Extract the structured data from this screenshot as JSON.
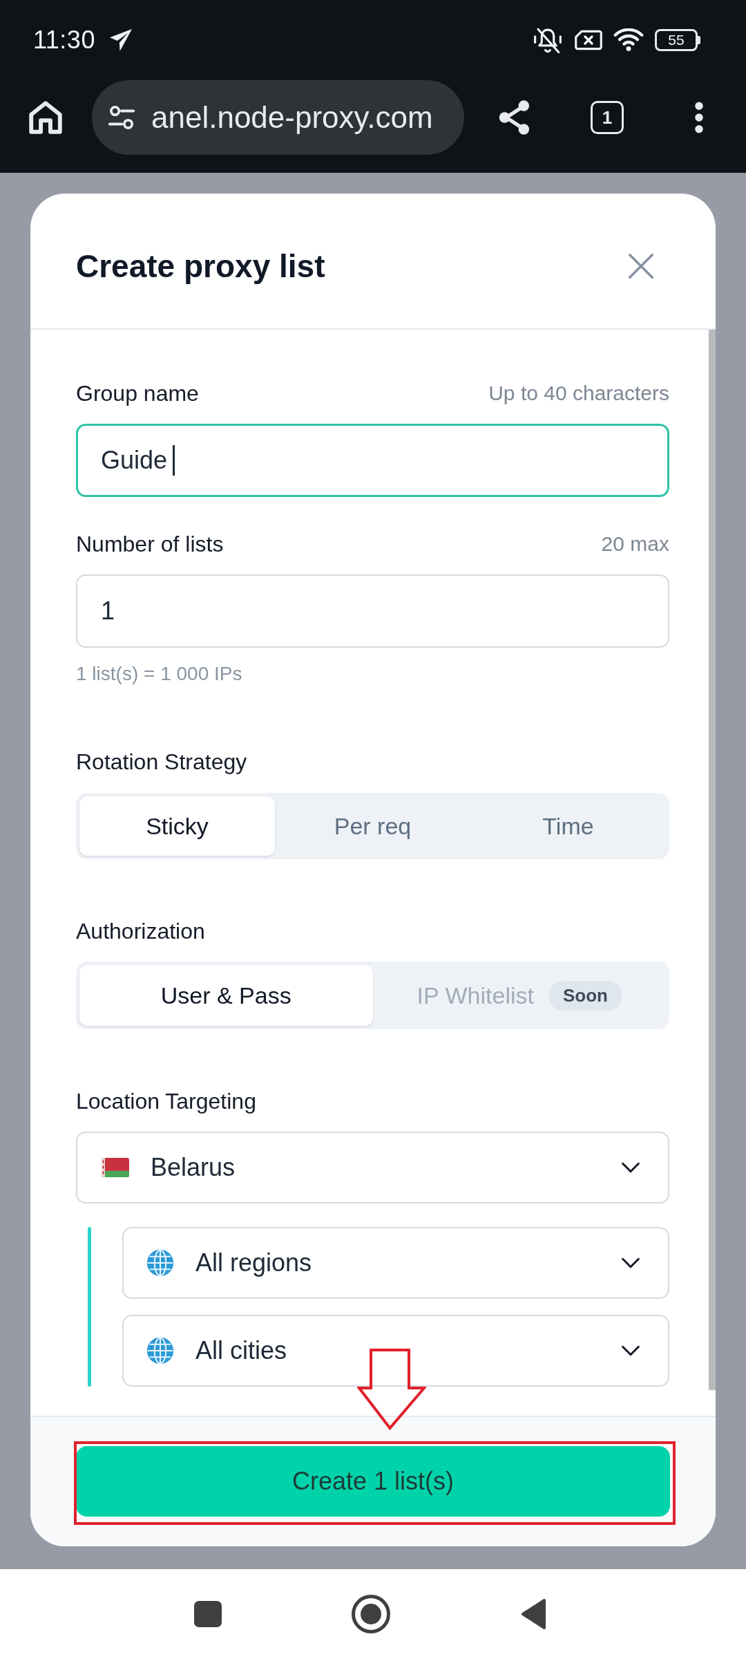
{
  "status_bar": {
    "time": "11:30",
    "battery": "55"
  },
  "browser_toolbar": {
    "url": "anel.node-proxy.com",
    "tab_count": "1"
  },
  "dialog": {
    "title": "Create proxy list"
  },
  "fields": [
    {
      "label": "Group name",
      "hint": "Up to 40 characters",
      "value": "Guide",
      "focused": true
    },
    {
      "label": "Number of lists",
      "hint": "20 max",
      "value": "1",
      "focused": false,
      "note": "1 list(s) = 1 000 IPs"
    }
  ],
  "rotation_strategy": {
    "label": "Rotation Strategy",
    "options": [
      {
        "label": "Sticky",
        "selected": true
      },
      {
        "label": "Per req",
        "selected": false
      },
      {
        "label": "Time",
        "selected": false
      }
    ]
  },
  "authorization": {
    "label": "Authorization",
    "options": [
      {
        "label": "User & Pass",
        "selected": true,
        "disabled": false
      },
      {
        "label": "IP Whitelist",
        "selected": false,
        "disabled": true,
        "badge": "Soon"
      }
    ]
  },
  "location_targeting": {
    "label": "Location Targeting",
    "country": "Belarus",
    "subdivisions": [
      {
        "value": "All regions"
      },
      {
        "value": "All cities"
      }
    ]
  },
  "submit_button": {
    "label": "Create 1 list(s)"
  }
}
